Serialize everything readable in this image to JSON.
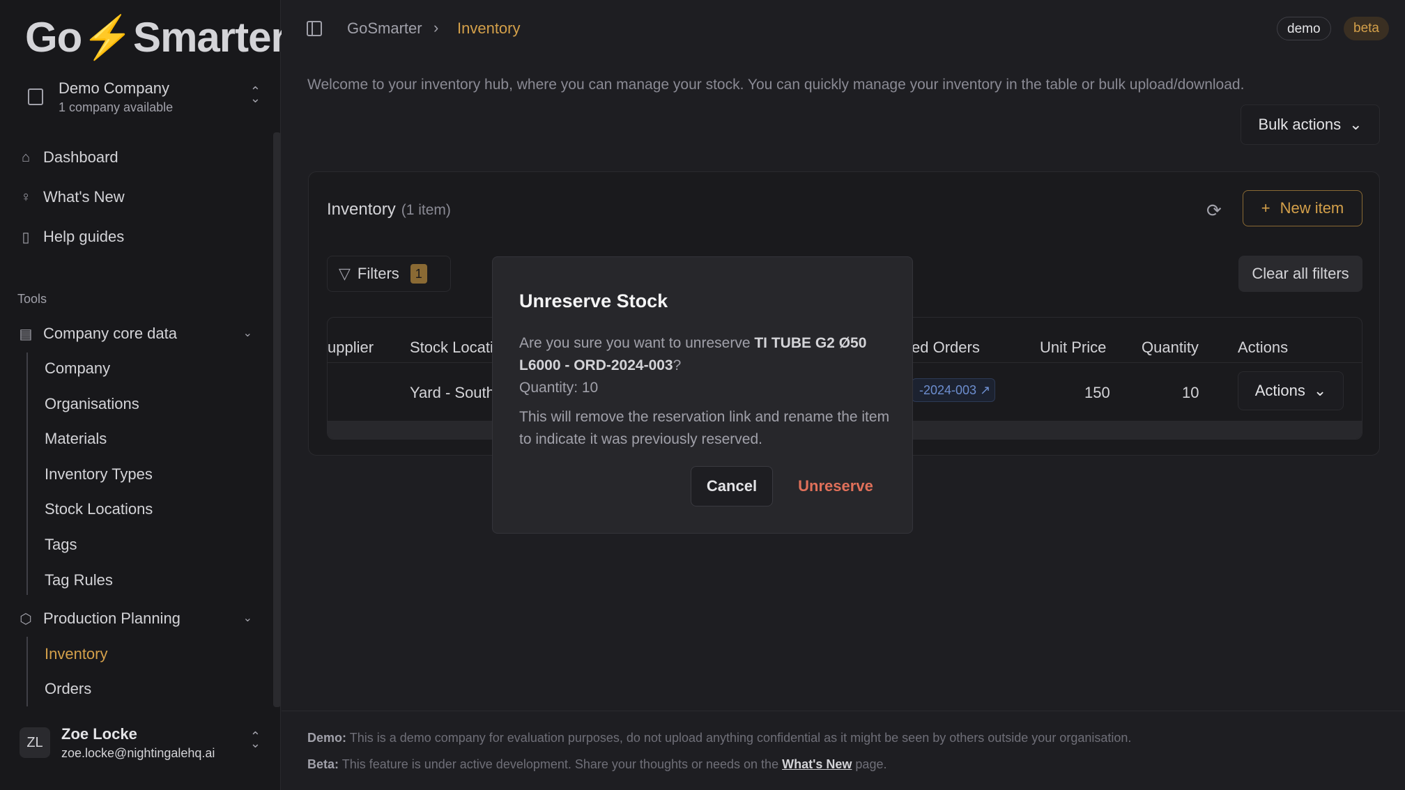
{
  "brand": {
    "logo_left": "Go",
    "logo_right": "Smarter"
  },
  "company": {
    "name": "Demo Company",
    "sub": "1 company available"
  },
  "nav": {
    "dashboard": "Dashboard",
    "whats_new": "What's New",
    "help": "Help guides"
  },
  "tools": {
    "label": "Tools",
    "core_data": "Company core data",
    "core_items": [
      "Company",
      "Organisations",
      "Materials",
      "Inventory Types",
      "Stock Locations",
      "Tags",
      "Tag Rules"
    ],
    "production": "Production Planning",
    "production_items": [
      "Inventory",
      "Orders"
    ]
  },
  "user": {
    "initials": "ZL",
    "name": "Zoe Locke",
    "email": "zoe.locke@nightingalehq.ai"
  },
  "breadcrumb": {
    "root": "GoSmarter",
    "current": "Inventory"
  },
  "tags": {
    "demo": "demo",
    "beta": "beta"
  },
  "welcome": "Welcome to your inventory hub, where you can manage your stock. You can quickly manage your inventory in the table or bulk upload/download.",
  "bulk_actions": "Bulk actions",
  "inventory": {
    "title": "Inventory",
    "count": "(1 item)",
    "new_item": "New item",
    "filters": "Filters",
    "filter_count": "1",
    "clear_filters": "Clear all filters",
    "columns": [
      "upplier",
      "Stock Locati",
      "ed Orders",
      "Unit Price",
      "Quantity",
      "Actions"
    ],
    "row": {
      "location": "Yard - South",
      "order": "-2024-003",
      "unit_price": "150",
      "quantity": "10",
      "actions": "Actions"
    }
  },
  "dialog": {
    "title": "Unreserve Stock",
    "body_prefix": "Are you sure you want to unreserve ",
    "item": "TI TUBE G2 Ø50 L6000 - ORD-2024-003",
    "body_suffix": "?",
    "quantity": "Quantity: 10",
    "note": "This will remove the reservation link and rename the item to indicate it was previously reserved.",
    "cancel": "Cancel",
    "confirm": "Unreserve"
  },
  "footer": {
    "demo_label": "Demo:",
    "demo_text": "This is a demo company for evaluation purposes, do not upload anything confidential as it might be seen by others outside your organisation.",
    "beta_label": "Beta:",
    "beta_text": "This feature is under active development. Share your thoughts or needs on the",
    "beta_link": "What's New",
    "beta_end": "page."
  },
  "colors": {
    "accent": "#d4a04a",
    "danger": "#e0705a",
    "link": "#6d8ecf"
  }
}
